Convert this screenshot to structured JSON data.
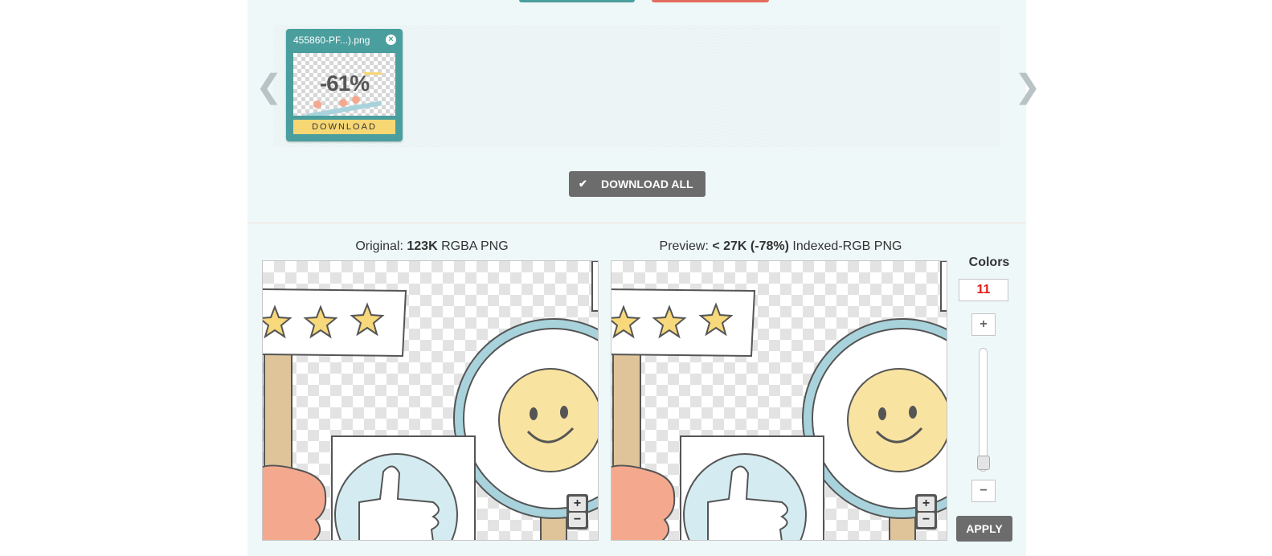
{
  "colors": {
    "panel_bg": "#eef8f8",
    "card_bg": "#4a9e9e",
    "download_btn": "#f7d774",
    "dark_btn": "#6c6c6c",
    "colors_value": "#e01b1b",
    "top_btn_left": "#4a9e9e",
    "top_btn_right": "#e36c5e"
  },
  "carousel": {
    "prev_icon": "chevron-left-icon",
    "next_icon": "chevron-right-icon",
    "prev_glyph": "❮",
    "next_glyph": "❯"
  },
  "file_card": {
    "name": "455860-PF...).png",
    "close_glyph": "×",
    "savings": "-61%",
    "download_label": "DOWNLOAD"
  },
  "download_all": {
    "check_glyph": "✔",
    "label": "DOWNLOAD ALL"
  },
  "original": {
    "prefix": "Original:",
    "size": "123K",
    "format": "RGBA PNG"
  },
  "preview": {
    "prefix": "Preview:",
    "size": "< 27K (-78%)",
    "format": "Indexed-RGB PNG"
  },
  "zoom": {
    "in": "+",
    "out": "−"
  },
  "controls": {
    "colors_label": "Colors",
    "colors_value": "11",
    "plus": "+",
    "minus": "−",
    "apply_label": "APPLY"
  }
}
